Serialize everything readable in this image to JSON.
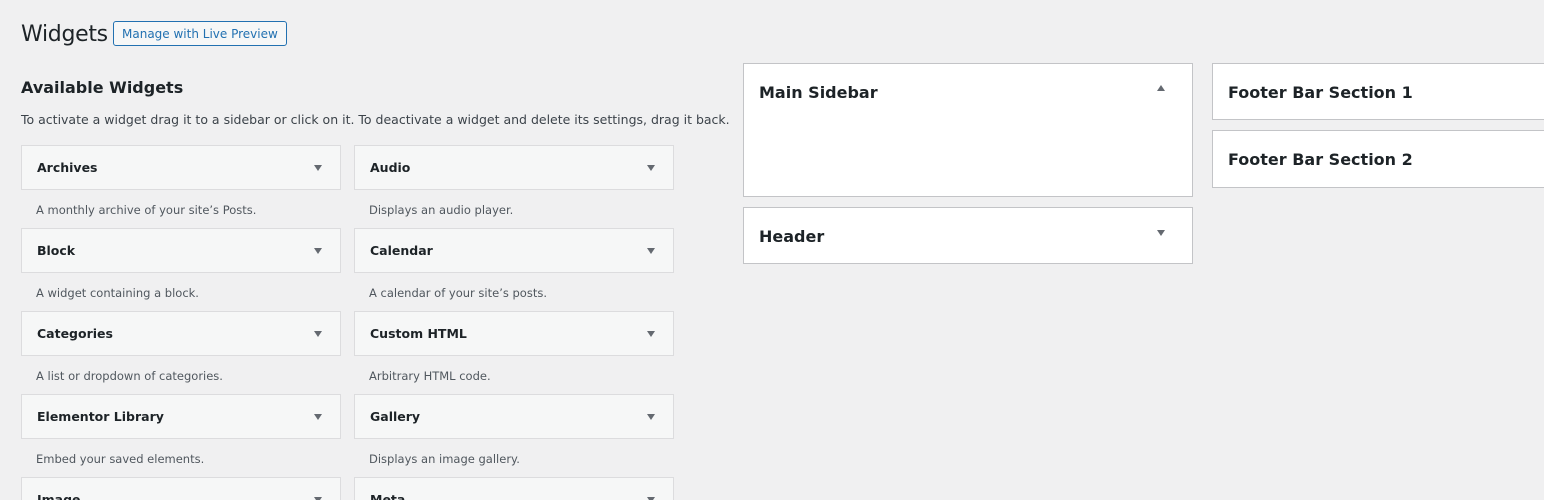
{
  "header": {
    "title": "Widgets",
    "live_preview_label": "Manage with Live Preview"
  },
  "available": {
    "title": "Available Widgets",
    "description": "To activate a widget drag it to a sidebar or click on it. To deactivate a widget and delete its settings, drag it back.",
    "widgets": [
      {
        "name": "Archives",
        "desc": "A monthly archive of your site’s Posts."
      },
      {
        "name": "Audio",
        "desc": "Displays an audio player."
      },
      {
        "name": "Block",
        "desc": "A widget containing a block."
      },
      {
        "name": "Calendar",
        "desc": "A calendar of your site’s posts."
      },
      {
        "name": "Categories",
        "desc": "A list or dropdown of categories."
      },
      {
        "name": "Custom HTML",
        "desc": "Arbitrary HTML code."
      },
      {
        "name": "Elementor Library",
        "desc": "Embed your saved elements."
      },
      {
        "name": "Gallery",
        "desc": "Displays an image gallery."
      },
      {
        "name": "Image",
        "desc": ""
      },
      {
        "name": "Meta",
        "desc": ""
      }
    ]
  },
  "sidebars": {
    "main_sidebar": "Main Sidebar",
    "header": "Header",
    "footer_1": "Footer Bar Section 1",
    "footer_2": "Footer Bar Section 2"
  },
  "colors": {
    "background": "#f0f0f1",
    "accent": "#2271b1"
  }
}
